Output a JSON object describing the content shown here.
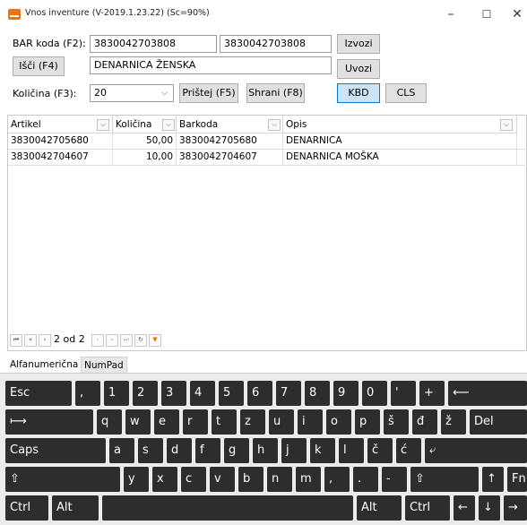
{
  "window": {
    "title": "Vnos inventure (V-2019.1.23.22)  (Sc=90%)",
    "minimize": "–",
    "maximize": "☐",
    "close": "✕"
  },
  "form": {
    "bar_label": "BAR koda (F2):",
    "bar_value": "3830042703808",
    "bar_value2": "3830042703808",
    "search_btn": "Išči (F4)",
    "desc_value": "DENARNICA ŽENSKA",
    "qty_label": "Količina (F3):",
    "qty_value": "20",
    "add_btn": "Prištej (F5)",
    "save_btn": "Shrani (F8)",
    "export_btn": "Izvozi",
    "import_btn": "Uvozi",
    "kbd_btn": "KBD",
    "cls_btn": "CLS"
  },
  "grid": {
    "headers": [
      "Artikel",
      "Količina",
      "Barkoda",
      "Opis"
    ],
    "rows": [
      {
        "artikel": "3830042705680",
        "kolicina": "50,00",
        "barkoda": "3830042705680",
        "opis": "DENARNICA"
      },
      {
        "artikel": "3830042704607",
        "kolicina": "10,00",
        "barkoda": "3830042704607",
        "opis": "DENARNICA MOŠKA"
      }
    ],
    "pager": "2 od 2"
  },
  "tabs": [
    "Alfanumerična",
    "NumPad"
  ],
  "keyboard": {
    "row1": [
      "Esc",
      ",",
      "1",
      "2",
      "3",
      "4",
      "5",
      "6",
      "7",
      "8",
      "9",
      "0",
      "'",
      "+",
      "⟵"
    ],
    "row2": [
      "⟼",
      "q",
      "w",
      "e",
      "r",
      "t",
      "z",
      "u",
      "i",
      "o",
      "p",
      "š",
      "đ",
      "ž",
      "Del"
    ],
    "row3": [
      "Caps",
      "a",
      "s",
      "d",
      "f",
      "g",
      "h",
      "j",
      "k",
      "l",
      "č",
      "ć",
      "⤶"
    ],
    "row4": [
      "⇧",
      "y",
      "x",
      "c",
      "v",
      "b",
      "n",
      "m",
      ",",
      ".",
      "-",
      "⇧",
      "↑",
      "Fn"
    ],
    "row5": [
      "Ctrl",
      "Alt",
      "",
      "Alt",
      "Ctrl",
      "←",
      "↓",
      "→"
    ]
  }
}
